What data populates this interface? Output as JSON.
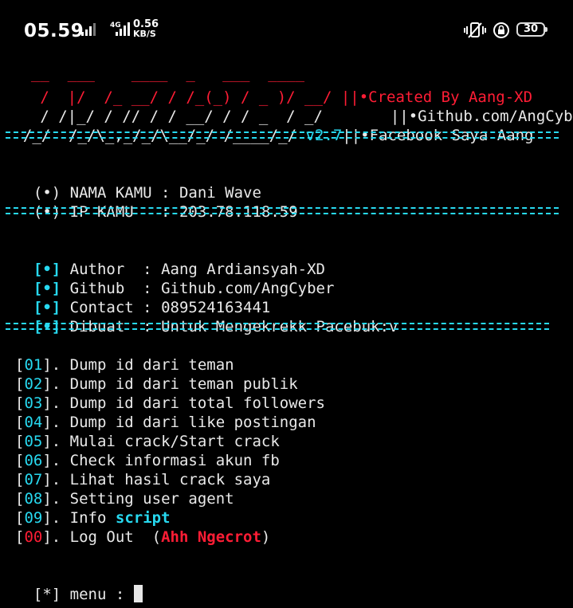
{
  "status_bar": {
    "time": "05.59",
    "network_type": "4G",
    "speed_value": "0.56",
    "speed_unit": "KB/S",
    "battery": "30",
    "icons": [
      "signal-icon",
      "signal-4g-icon",
      "mute-vibrate-icon",
      "rotation-lock-icon",
      "battery-icon"
    ]
  },
  "banner": {
    "line1": "  __  ___    ____  _   ___  ____",
    "line2": " /  |/  /_ __/ / /_(_) / _ )/ __/ ",
    "line3": " / /|_/ / // / / __/ / / _  / _/  ",
    "line4": "/_/  /_/\\_,_/_/\\__/_/ /____/_/ ",
    "version": "v2.7",
    "pipes": "||",
    "created": "•Created By Aang-XD",
    "github": "•Github.com/AngCyber",
    "facebook": "•Facebook Saya Aang"
  },
  "user": {
    "bullet": "(•)",
    "name_label": "NAMA KAMU : ",
    "name_value": "Dani Wave",
    "ip_label": "IP KAMU   : ",
    "ip_value": "203.78.118.59"
  },
  "info": {
    "bullet": "[•]",
    "rows": [
      {
        "label": " Author  : ",
        "value": "Aang Ardiansyah-XD"
      },
      {
        "label": " Github  : ",
        "value": "Github.com/AngCyber"
      },
      {
        "label": " Contact : ",
        "value": "089524163441"
      },
      {
        "label": " Dibuat  : ",
        "value": "Untuk Mengekrekk Pacebuk:v"
      }
    ]
  },
  "menu": {
    "items": [
      {
        "num": "01",
        "text": ". Dump id dari teman"
      },
      {
        "num": "02",
        "text": ". Dump id dari teman publik"
      },
      {
        "num": "03",
        "text": ". Dump id dari total followers"
      },
      {
        "num": "04",
        "text": ". Dump id dari like postingan"
      },
      {
        "num": "05",
        "text": ". Mulai crack/Start crack"
      },
      {
        "num": "06",
        "text": ". Check informasi akun fb"
      },
      {
        "num": "07",
        "text": ". Lihat hasil crack saya"
      },
      {
        "num": "08",
        "text": ". Setting user agent"
      },
      {
        "num": "09",
        "text": ". Info ",
        "extra": "script"
      },
      {
        "num": "00",
        "text": ". Log Out  (",
        "extra": "Ahh Ngecrot",
        "tail": ")"
      }
    ]
  },
  "prompt": {
    "label": "[*] menu : "
  },
  "colors": {
    "red": "#ff1d35",
    "cyan": "#27d9f0",
    "text": "#e9e9e9",
    "background": "#000000"
  }
}
